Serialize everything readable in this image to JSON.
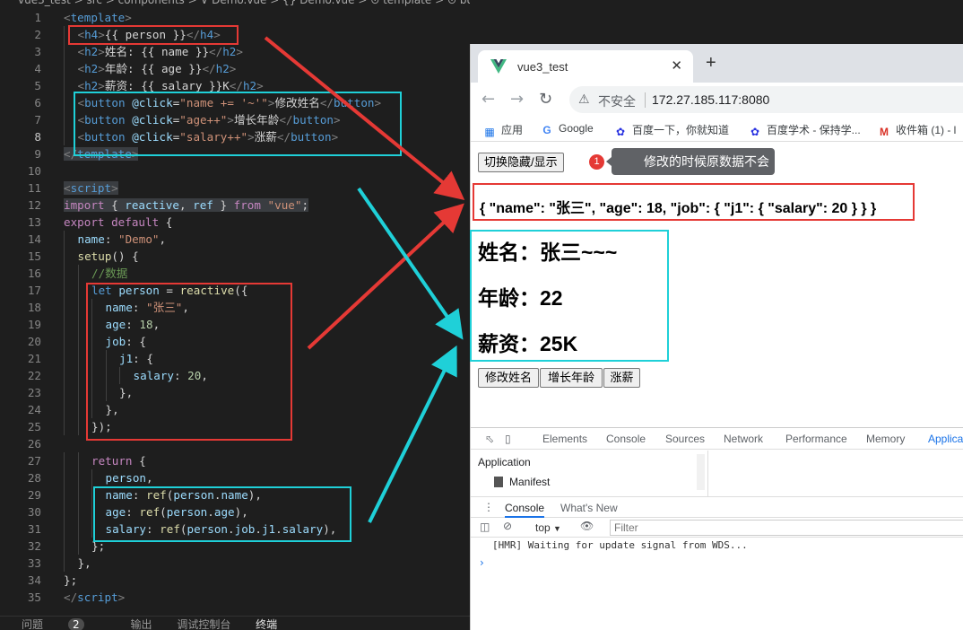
{
  "editor": {
    "breadcrumb": "vue3_test > src > components > ∨ Demo.vue > {} Demo.vue > ⊙ template > ⊙ button",
    "panel_tabs": [
      "问题",
      "输出",
      "调试控制台",
      "终端"
    ],
    "problems_count": "2",
    "lines": [
      "1",
      "2",
      "3",
      "4",
      "5",
      "6",
      "7",
      "8",
      "9",
      "10",
      "11",
      "12",
      "13",
      "14",
      "15",
      "16",
      "17",
      "18",
      "19",
      "20",
      "21",
      "22",
      "23",
      "24",
      "25",
      "26",
      "27",
      "28",
      "29",
      "30",
      "31",
      "32",
      "33",
      "34",
      "35"
    ]
  },
  "browser": {
    "tab_title": "vue3_test",
    "tab_close": "✕",
    "new_tab": "+",
    "security_label": "不安全",
    "url": "172.27.185.117:8080",
    "bookmarks": [
      "应用",
      "Google",
      "百度一下，你就知道",
      "百度学术 - 保持学...",
      "收件箱 (1) - l"
    ]
  },
  "page": {
    "toggle_button": "切换隐藏/显示",
    "note_number": "1",
    "note_text": "修改的时候原数据不会发生变化",
    "json_text": "{ \"name\": \"张三\", \"age\": 18, \"job\": { \"j1\": { \"salary\": 20 } } }",
    "name_line": "姓名：张三~~~",
    "age_line": "年龄：22",
    "salary_line": "薪资：25K",
    "buttons": [
      "修改姓名",
      "增长年龄",
      "涨薪"
    ]
  },
  "devtools": {
    "tabs": [
      "Elements",
      "Console",
      "Sources",
      "Network",
      "Performance",
      "Memory",
      "Applica"
    ],
    "app_section": "Application",
    "manifest": "Manifest",
    "console_tabs": [
      "Console",
      "What's New"
    ],
    "context": "top",
    "filter_placeholder": "Filter",
    "message": "[HMR] Waiting for update signal from WDS...",
    "prompt": "›"
  },
  "colors": {
    "highlight_red": "#e53935",
    "highlight_cyan": "#1fd0d8",
    "editor_bg": "#1e1e1e"
  }
}
